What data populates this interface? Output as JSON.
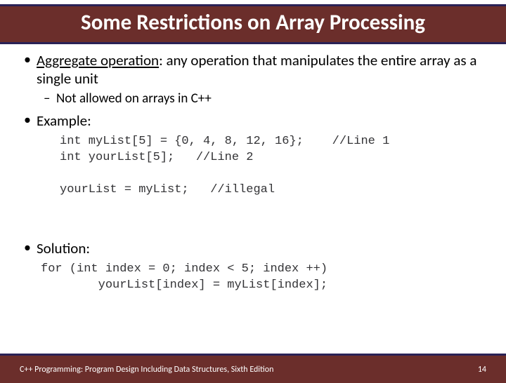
{
  "title": "Some Restrictions on Array Processing",
  "bullets": {
    "aggregate_term": "Aggregate operation",
    "aggregate_rest": ": any operation that manipulates the entire array as a single unit",
    "aggregate_sub": "Not allowed on arrays in C++",
    "example_label": "Example:",
    "solution_label": "Solution:"
  },
  "code": {
    "example": "int myList[5] = {0, 4, 8, 12, 16};    //Line 1\nint yourList[5];   //Line 2\n\nyourList = myList;   //illegal",
    "solution": "for (int index = 0; index < 5; index ++)\n        yourList[index] = myList[index];"
  },
  "footer": {
    "left": "C++ Programming: Program Design Including Data Structures, Sixth Edition",
    "right": "14"
  }
}
